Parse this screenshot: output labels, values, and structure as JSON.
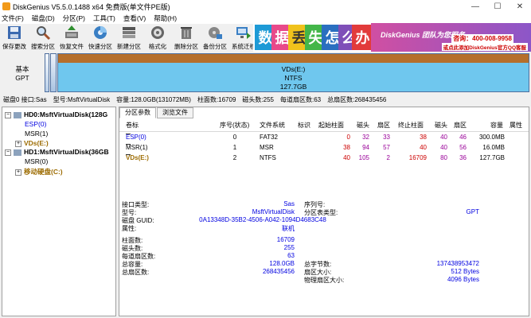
{
  "window": {
    "title": "DiskGenius V5.5.0.1488 x64 免费版(单文件PE版)",
    "controls": [
      "—",
      "☐",
      "✕"
    ]
  },
  "menu": [
    "文件(F)",
    "磁盘(D)",
    "分区(P)",
    "工具(T)",
    "查看(V)",
    "帮助(H)"
  ],
  "toolbar": [
    {
      "label": "保存更改",
      "icon": "save-icon"
    },
    {
      "label": "搜索分区",
      "icon": "search-partition-icon"
    },
    {
      "label": "恢复文件",
      "icon": "recover-file-icon"
    },
    {
      "label": "快速分区",
      "icon": "quick-partition-icon"
    },
    {
      "label": "新建分区",
      "icon": "new-partition-icon"
    },
    {
      "label": "格式化",
      "icon": "format-icon"
    },
    {
      "label": "删除分区",
      "icon": "delete-partition-icon"
    },
    {
      "label": "备份分区",
      "icon": "backup-partition-icon"
    },
    {
      "label": "系统迁移",
      "icon": "system-migration-icon"
    }
  ],
  "banner": {
    "chars": [
      "数",
      "据",
      "丢",
      "失",
      "怎",
      "么",
      "办"
    ],
    "team": "DiskGenius 团队为您服务",
    "phone": "咨询：400-008-9958",
    "qq": "或点此添加DiskGenius官方QQ客服"
  },
  "diskmap": {
    "label_line1": "基本",
    "label_line2": "GPT",
    "main_part": {
      "name": "VDs(E:)",
      "fs": "NTFS",
      "size": "127.7GB"
    }
  },
  "infobar": [
    "磁盘0 接口:Sas",
    "型号:MsftVirtualDisk",
    "容量:128.0GB(131072MB)",
    "柱面数:16709",
    "磁头数:255",
    "每道扇区数:63",
    "总扇区数:268435456"
  ],
  "tree": {
    "hd0": "HD0:MsftVirtualDisk(128G",
    "hd0_parts": [
      "ESP(0)",
      "MSR(1)",
      "VDs(E:)"
    ],
    "hd1": "HD1:MsftVirtualDisk(36GB",
    "hd1_parts": [
      "MSR(0)",
      "移动硬盘(C:)"
    ]
  },
  "tabs": [
    "分区参数",
    "浏览文件"
  ],
  "table": {
    "headers": [
      "卷标",
      "序号(状态)",
      "文件系统",
      "标识",
      "起始柱面",
      "磁头",
      "扇区",
      "终止柱面",
      "磁头",
      "扇区",
      "容量",
      "属性"
    ],
    "rows": [
      {
        "label": "ESP(0)",
        "seq": "0",
        "fs": "FAT32",
        "scyl": "0",
        "shead": "32",
        "ssec": "33",
        "ecyl": "38",
        "ehead": "40",
        "esec": "46",
        "cap": "300.0MB"
      },
      {
        "label": "MSR(1)",
        "seq": "1",
        "fs": "MSR",
        "scyl": "38",
        "shead": "94",
        "ssec": "57",
        "ecyl": "40",
        "ehead": "40",
        "esec": "56",
        "cap": "16.0MB"
      },
      {
        "label": "VDs(E:)",
        "seq": "2",
        "fs": "NTFS",
        "scyl": "40",
        "shead": "105",
        "ssec": "2",
        "ecyl": "16709",
        "ehead": "80",
        "esec": "36",
        "cap": "127.7GB"
      }
    ]
  },
  "details": {
    "iface_k": "接口类型:",
    "iface_v": "Sas",
    "sn_k": "序列号:",
    "sn_v": "",
    "model_k": "型号:",
    "model_v": "MsftVirtualDisk",
    "ptype_k": "分区表类型:",
    "ptype_v": "GPT",
    "guid_k": "磁盘 GUID:",
    "guid_v": "0A13348D-35B2-4506-A042-1094D4683C48",
    "state_k": "属性:",
    "state_v": "联机",
    "cyl_k": "柱面数:",
    "cyl_v": "16709",
    "heads_k": "磁头数:",
    "heads_v": "255",
    "spt_k": "每道扇区数:",
    "spt_v": "63",
    "cap_k": "总容量:",
    "cap_v": "128.0GB",
    "bytes_k": "总字节数:",
    "bytes_v": "137438953472",
    "secs_k": "总扇区数:",
    "secs_v": "268435456",
    "secsize_k": "扇区大小:",
    "secsize_v": "512 Bytes",
    "phys_k": "物理扇区大小:",
    "phys_v": "4096 Bytes"
  }
}
